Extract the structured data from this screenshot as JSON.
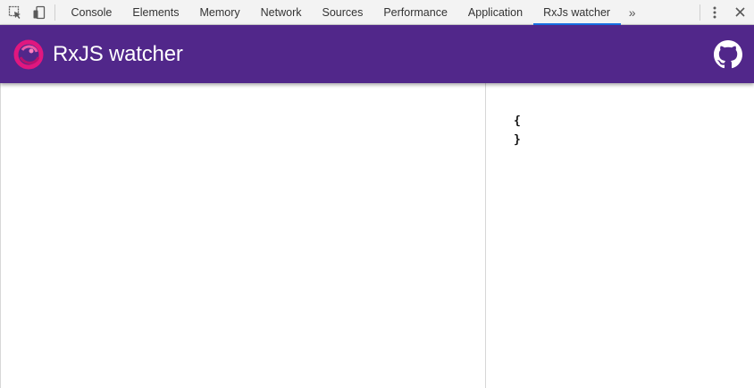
{
  "devtools": {
    "tabs": [
      {
        "label": "Console"
      },
      {
        "label": "Elements"
      },
      {
        "label": "Memory"
      },
      {
        "label": "Network"
      },
      {
        "label": "Sources"
      },
      {
        "label": "Performance"
      },
      {
        "label": "Application"
      },
      {
        "label": "RxJs watcher"
      }
    ],
    "active_tab": "RxJs watcher",
    "accent_color": "#1a73e8",
    "icons": [
      "inspect-element-icon",
      "device-toggle-icon",
      "more-tabs-chevron-icon",
      "kebab-menu-icon",
      "close-icon"
    ],
    "overflow_glyph": "»"
  },
  "app": {
    "title": "RxJS watcher",
    "header_color": "#51278a",
    "logo": "rxjs-logo-icon",
    "github": "github-icon"
  },
  "json_view": {
    "open": "{",
    "close": "}"
  }
}
